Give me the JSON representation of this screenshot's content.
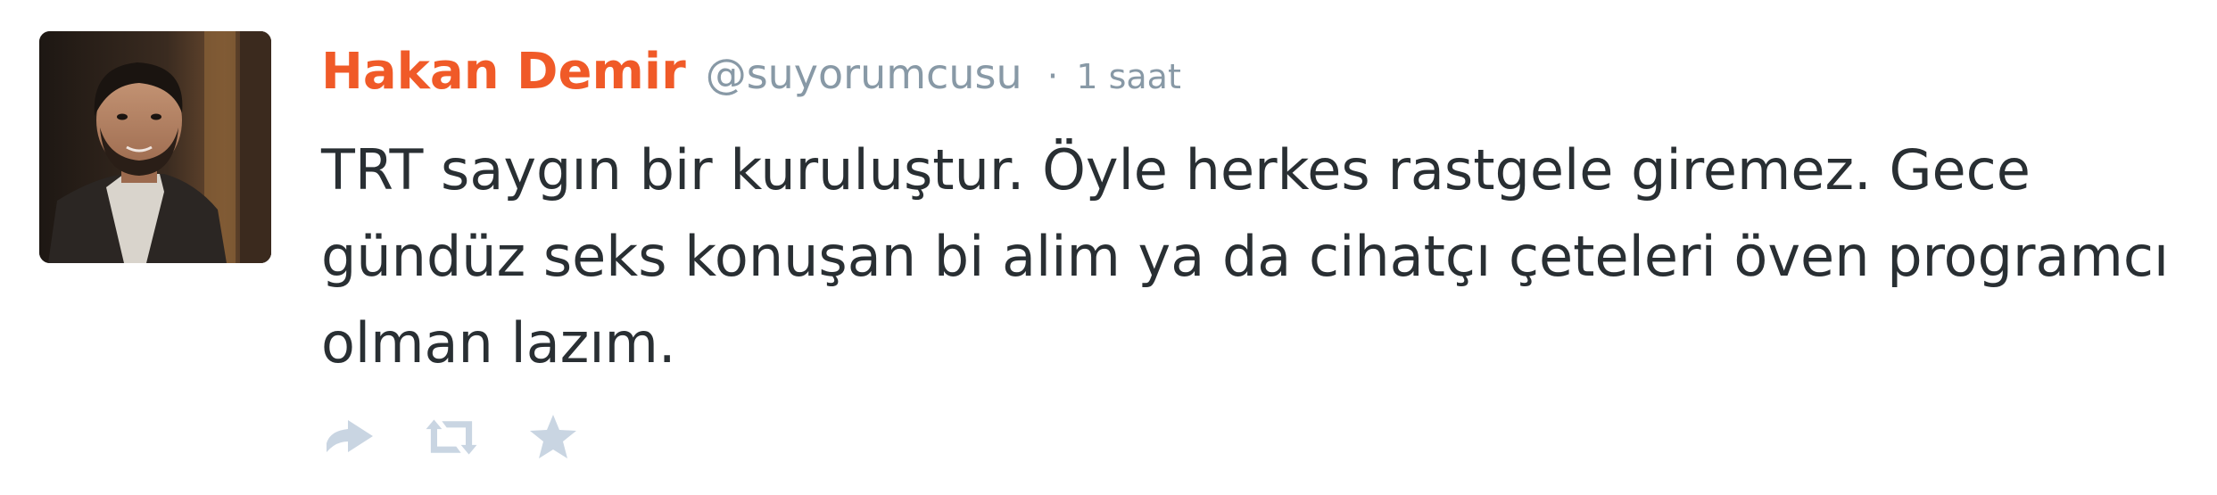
{
  "tweet": {
    "author_name": "Hakan Demir",
    "author_handle": "@suyorumcusu",
    "separator": "·",
    "timestamp": "1 saat",
    "text": "TRT saygın bir kuruluştur. Öyle herkes rastgele giremez. Gece gündüz seks konuşan bi alim ya da cihatçı çeteleri öven programcı olman lazım."
  },
  "actions": [
    {
      "name": "reply-icon"
    },
    {
      "name": "retweet-icon"
    },
    {
      "name": "favorite-icon"
    }
  ],
  "colors": {
    "author_name": "#f05a28",
    "meta_text": "#8899a6",
    "body_text": "#292f33",
    "action_icons": "#c9d5e2"
  }
}
